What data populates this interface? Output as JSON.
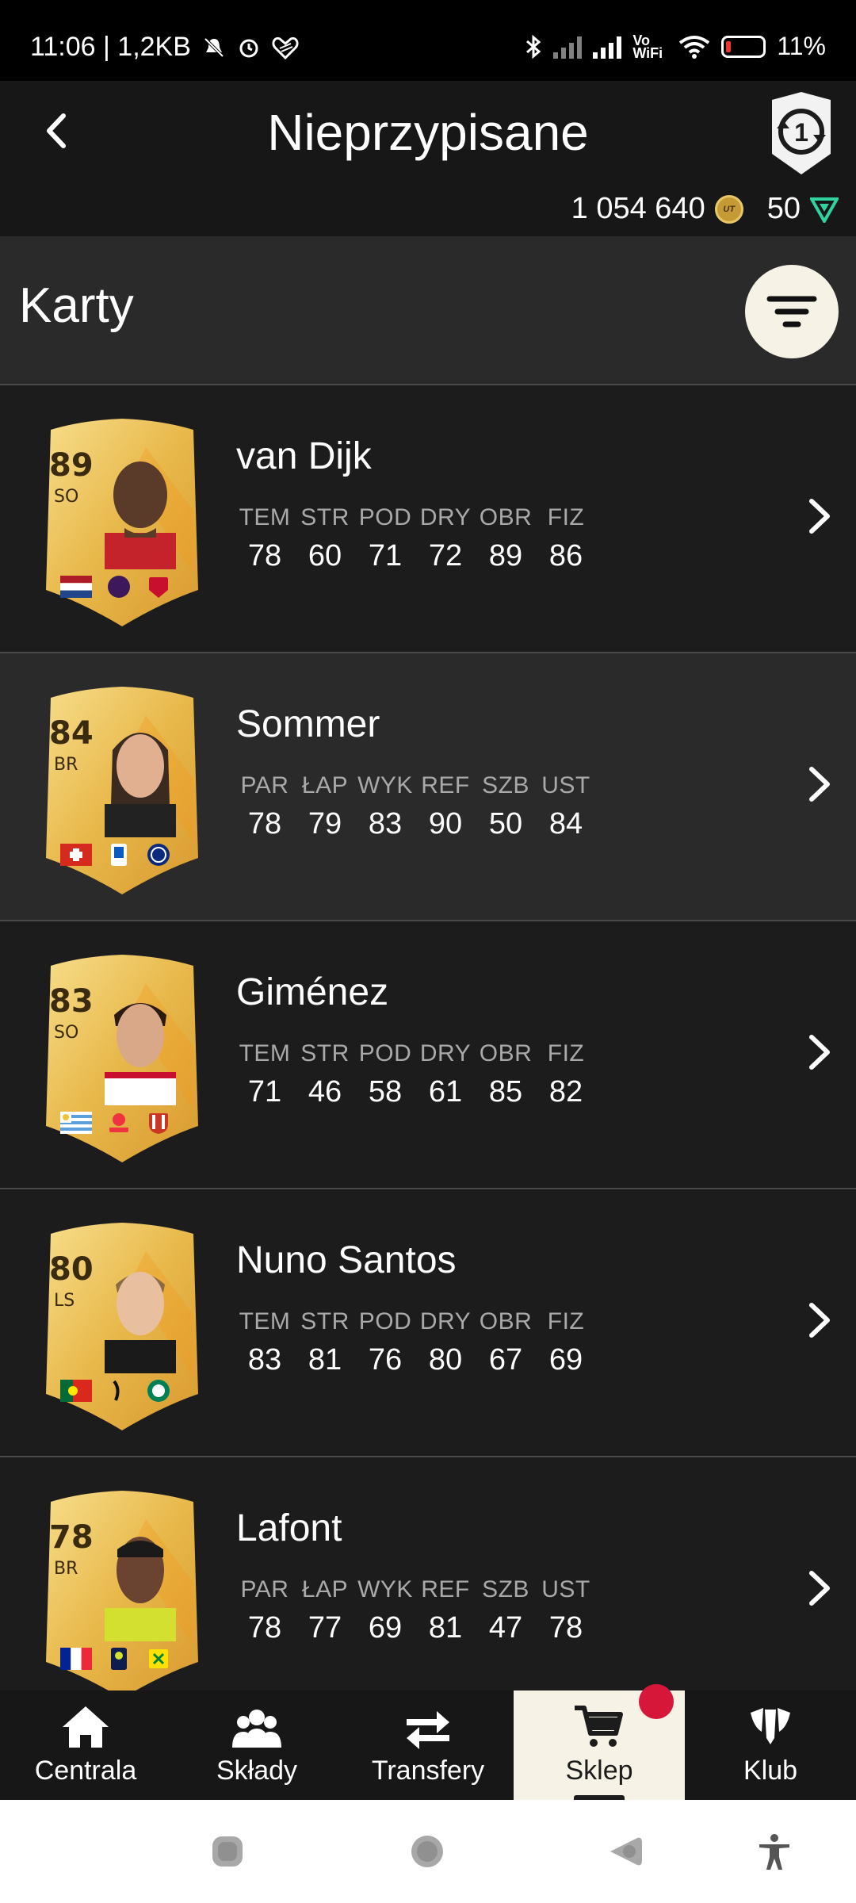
{
  "status_bar": {
    "time_info": "11:06 | 1,2KB",
    "wifi_label": "Vo WiFi",
    "battery": "11%"
  },
  "header": {
    "title": "Nieprzypisane",
    "coins": "1 054 640",
    "points": "50",
    "coin_text": "UT"
  },
  "section": {
    "title": "Karty"
  },
  "players": [
    {
      "name": "van Dijk",
      "rating": "89",
      "position": "SO",
      "labels": [
        "TEM",
        "STR",
        "POD",
        "DRY",
        "OBR",
        "FIZ"
      ],
      "values": [
        "78",
        "60",
        "71",
        "72",
        "89",
        "86"
      ]
    },
    {
      "name": "Sommer",
      "rating": "84",
      "position": "BR",
      "labels": [
        "PAR",
        "ŁAP",
        "WYK",
        "REF",
        "SZB",
        "UST"
      ],
      "values": [
        "78",
        "79",
        "83",
        "90",
        "50",
        "84"
      ]
    },
    {
      "name": "Giménez",
      "rating": "83",
      "position": "SO",
      "labels": [
        "TEM",
        "STR",
        "POD",
        "DRY",
        "OBR",
        "FIZ"
      ],
      "values": [
        "71",
        "46",
        "58",
        "61",
        "85",
        "82"
      ]
    },
    {
      "name": "Nuno Santos",
      "rating": "80",
      "position": "LS",
      "labels": [
        "TEM",
        "STR",
        "POD",
        "DRY",
        "OBR",
        "FIZ"
      ],
      "values": [
        "83",
        "81",
        "76",
        "80",
        "67",
        "69"
      ]
    },
    {
      "name": "Lafont",
      "rating": "78",
      "position": "BR",
      "labels": [
        "PAR",
        "ŁAP",
        "WYK",
        "REF",
        "SZB",
        "UST"
      ],
      "values": [
        "78",
        "77",
        "69",
        "81",
        "47",
        "78"
      ]
    }
  ],
  "nav": [
    {
      "label": "Centrala",
      "icon": "home-icon"
    },
    {
      "label": "Składy",
      "icon": "squads-icon"
    },
    {
      "label": "Transfery",
      "icon": "transfer-icon"
    },
    {
      "label": "Sklep",
      "icon": "cart-icon",
      "active": true
    },
    {
      "label": "Klub",
      "icon": "club-icon"
    }
  ],
  "colors": {
    "background": "#1c1c1c",
    "card_gold": "#e8b84a",
    "accent_cream": "#f6f3e6",
    "notification": "#d6173a"
  }
}
